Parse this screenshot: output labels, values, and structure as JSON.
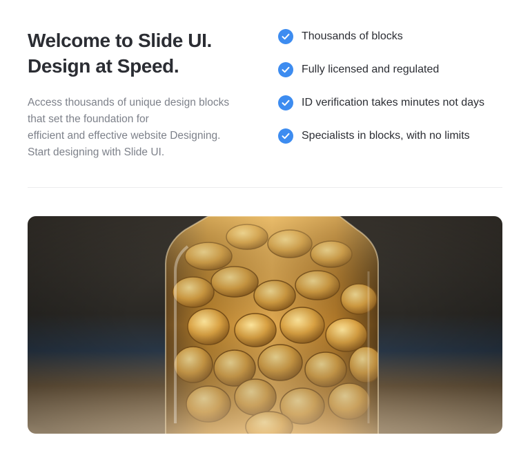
{
  "hero": {
    "title_line_1": "Welcome to Slide UI.",
    "title_line_2": "Design at Speed.",
    "description_lines": [
      "Access thousands of unique design blocks",
      "that set the foundation for",
      "efficient and effective website Designing.",
      "Start designing with Slide UI."
    ]
  },
  "features": [
    {
      "icon": "check-circle-icon",
      "label": "Thousands of blocks"
    },
    {
      "icon": "check-circle-icon",
      "label": "Fully licensed and regulated"
    },
    {
      "icon": "check-circle-icon",
      "label": "ID verification takes minutes not days"
    },
    {
      "icon": "check-circle-icon",
      "label": "Specialists in blocks, with no limits"
    }
  ],
  "colors": {
    "accent": "#3d8cf0",
    "heading": "#2b2d33",
    "body_text": "#7d818a",
    "divider": "#ececee"
  },
  "image": {
    "subject": "coins-in-glass-jar"
  }
}
